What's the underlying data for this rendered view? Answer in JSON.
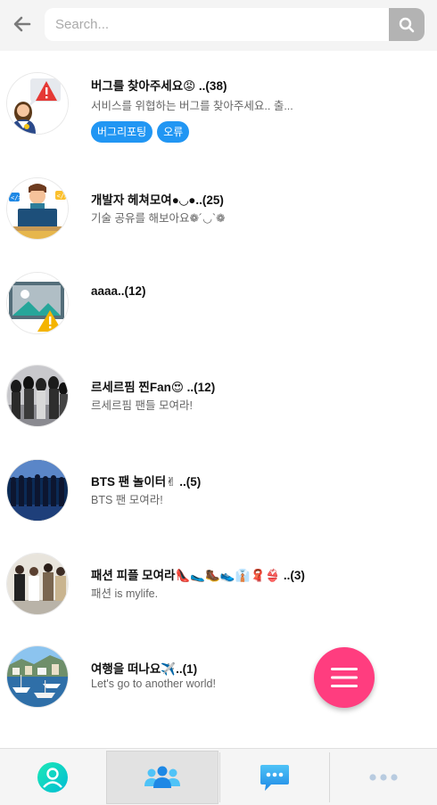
{
  "search": {
    "placeholder": "Search..."
  },
  "rooms": [
    {
      "title": "버그를 찾아주세요😡 ..(38)",
      "desc": "서비스를 위협하는 버그를 찾아주세요.. 출...",
      "tags": [
        "버그리포팅",
        "오류"
      ],
      "avatar": "warning-person-icon"
    },
    {
      "title": "개발자 헤쳐모여●◡●..(25)",
      "desc": "기술 공유를 해보아요❁´◡`❁",
      "avatar": "developer-icon"
    },
    {
      "title": "aaaa..(12)",
      "desc": "",
      "avatar": "broken-image-icon"
    },
    {
      "title": "르세르핌 찐Fan😍 ..(12)",
      "desc": "르세르핌 팬들 모여라!",
      "avatar": "group-photo"
    },
    {
      "title": "BTS 팬 놀이터✌ ..(5)",
      "desc": "BTS 팬 모여라!",
      "avatar": "concert-photo"
    },
    {
      "title": "패션 피플 모여라👠🥿🥾👟👔🧣👙 ..(3)",
      "desc": "패션 is mylife.",
      "avatar": "fashion-photo"
    },
    {
      "title": "여행을 떠나요✈️..(1)",
      "desc": "Let's go to another world!",
      "avatar": "harbor-photo"
    }
  ],
  "colors": {
    "accent": "#2196f3",
    "fab": "#ff3d7f",
    "nav_active_bg": "#e2e2e2"
  },
  "nav": [
    "profile-icon",
    "group-icon",
    "chat-icon",
    "more-icon"
  ]
}
